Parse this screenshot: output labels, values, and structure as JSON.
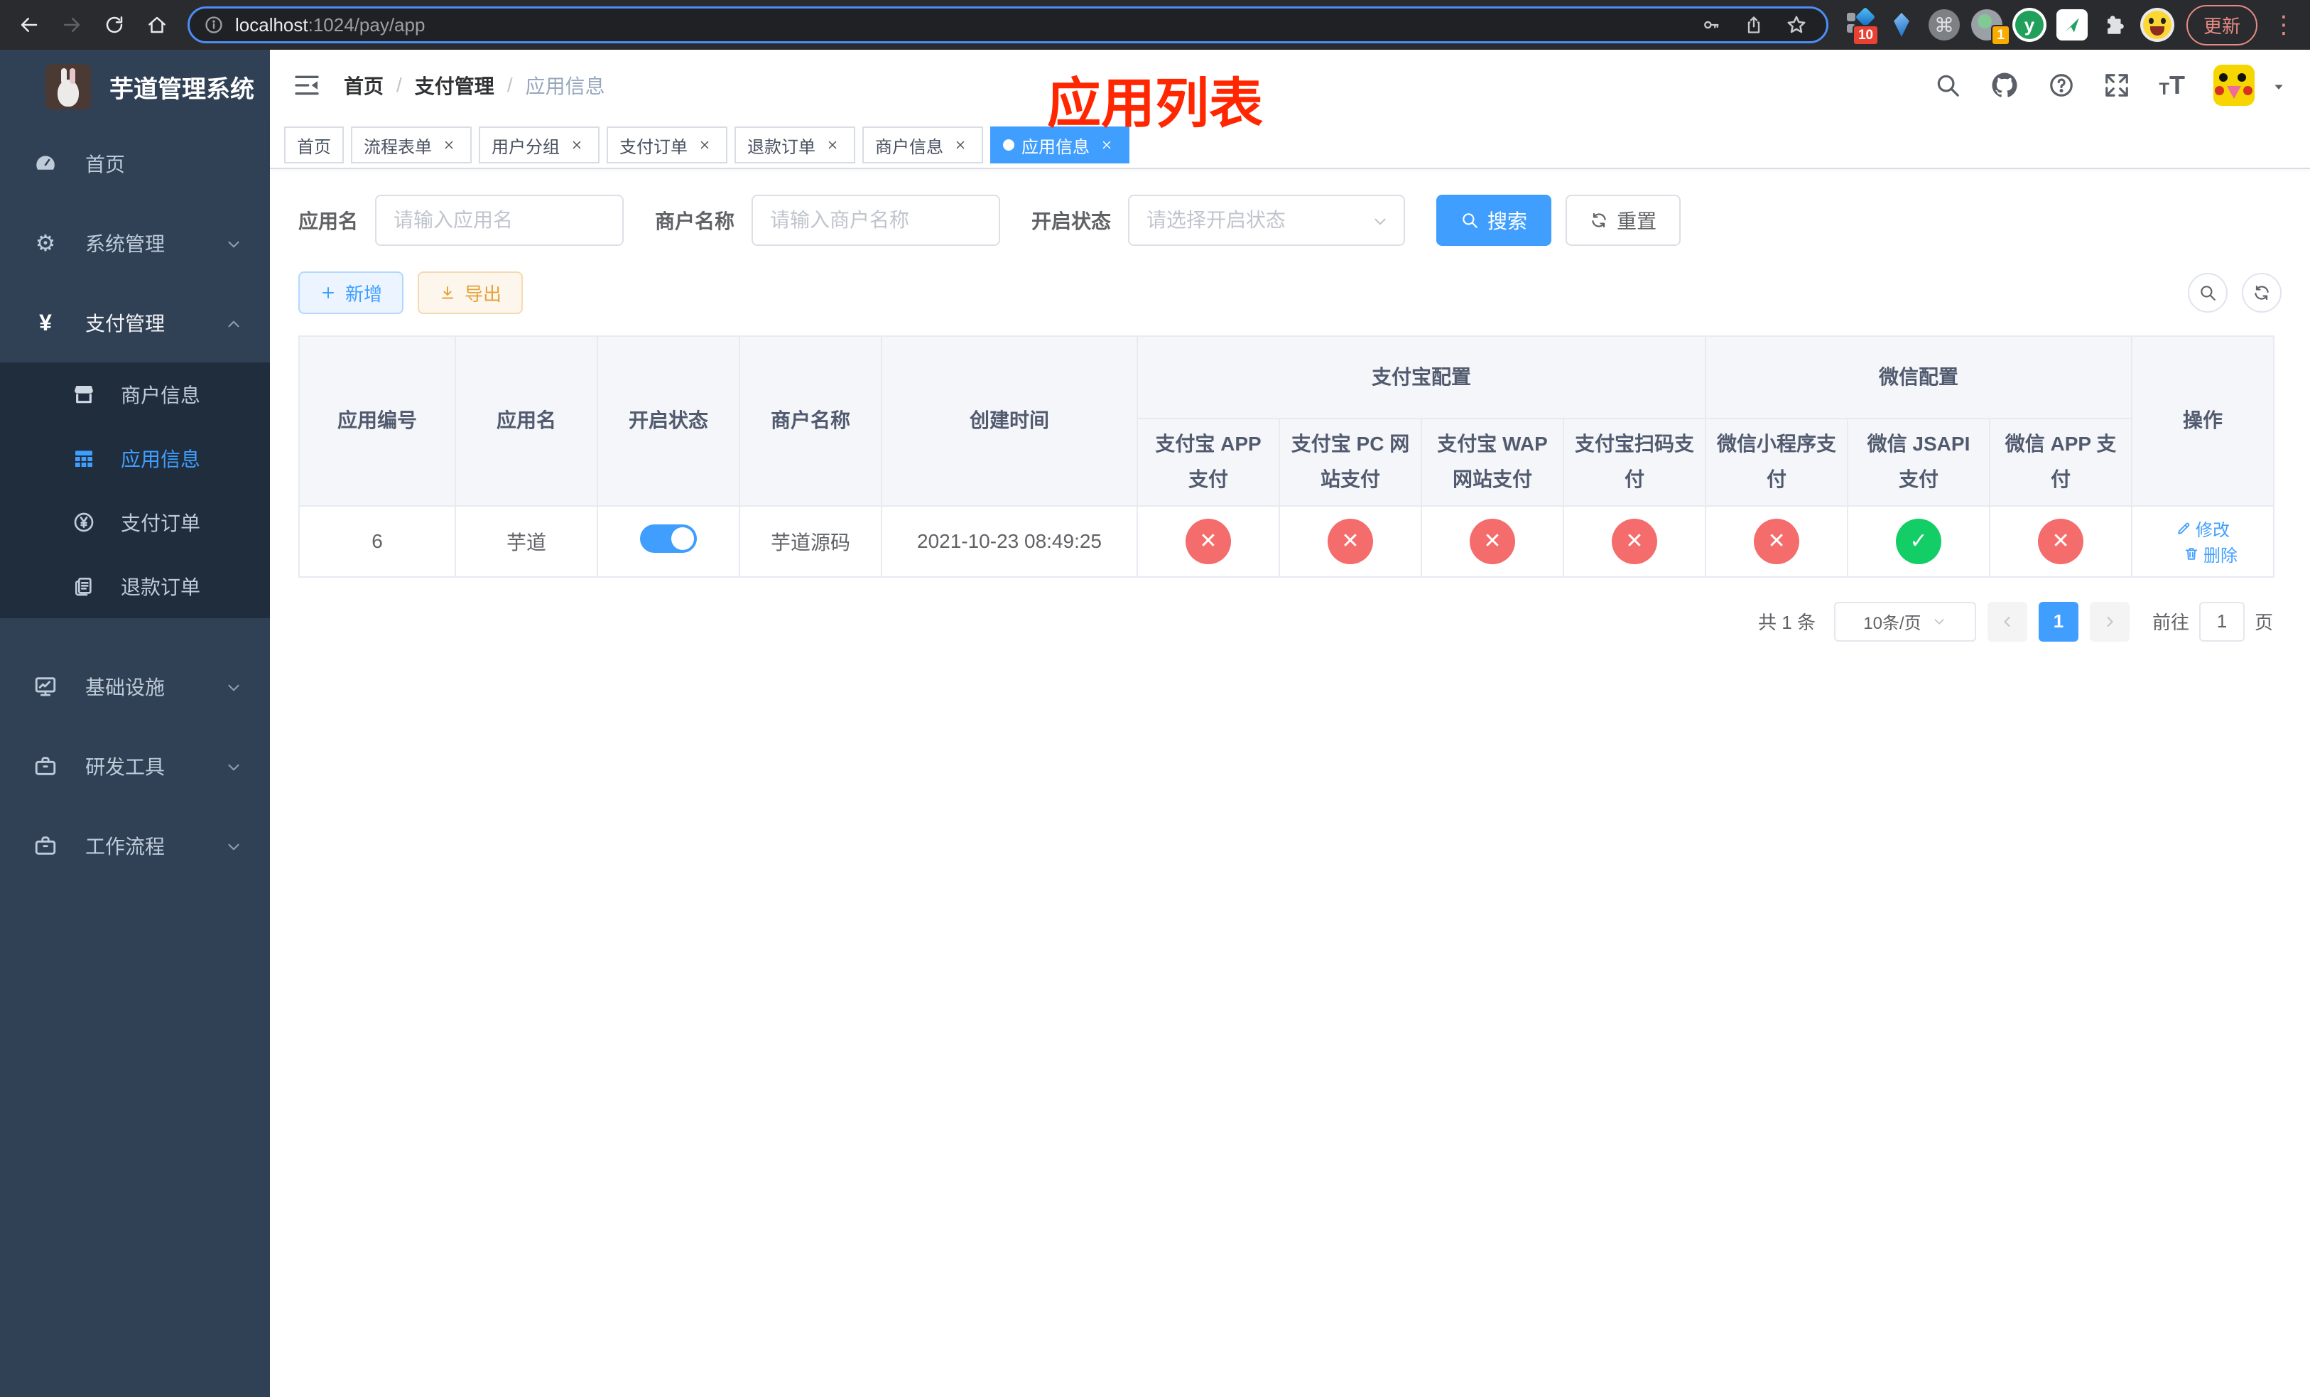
{
  "browser": {
    "url_host": "localhost",
    "url_rest": ":1024/pay/app",
    "update_label": "更新",
    "ext_badge_red": "10",
    "ext_badge_orange": "1",
    "y_ext_letter": "y",
    "cmd_glyph": "⌘",
    "dots_glyph": "⋮"
  },
  "sidebar": {
    "title": "芋道管理系统",
    "items": [
      {
        "label": "首页"
      },
      {
        "label": "系统管理"
      },
      {
        "label": "支付管理"
      },
      {
        "label": "商户信息"
      },
      {
        "label": "应用信息"
      },
      {
        "label": "支付订单"
      },
      {
        "label": "退款订单"
      },
      {
        "label": "基础设施"
      },
      {
        "label": "研发工具"
      },
      {
        "label": "工作流程"
      }
    ],
    "yen_glyph": "¥",
    "gear_glyph": "⚙"
  },
  "breadcrumb": {
    "items": [
      "首页",
      "支付管理",
      "应用信息"
    ],
    "separator": "/"
  },
  "annotation": {
    "title": "应用列表"
  },
  "tabs": [
    {
      "label": "首页"
    },
    {
      "label": "流程表单"
    },
    {
      "label": "用户分组"
    },
    {
      "label": "支付订单"
    },
    {
      "label": "退款订单"
    },
    {
      "label": "商户信息"
    },
    {
      "label": "应用信息"
    }
  ],
  "filters": {
    "app_name_label": "应用名",
    "app_name_placeholder": "请输入应用名",
    "merchant_label": "商户名称",
    "merchant_placeholder": "请输入商户名称",
    "status_label": "开启状态",
    "status_placeholder": "请选择开启状态",
    "search_label": "搜索",
    "reset_label": "重置"
  },
  "toolbar": {
    "add_label": "新增",
    "export_label": "导出"
  },
  "table": {
    "columns": {
      "id": "应用编号",
      "name": "应用名",
      "status": "开启状态",
      "merchant": "商户名称",
      "created": "创建时间",
      "op": "操作"
    },
    "groups": {
      "alipay": "支付宝配置",
      "wechat": "微信配置"
    },
    "sub_columns": [
      "支付宝 APP 支付",
      "支付宝 PC 网站支付",
      "支付宝 WAP 网站支付",
      "支付宝扫码支付",
      "微信小程序支付",
      "微信 JSAPI 支付",
      "微信 APP 支付"
    ],
    "row": {
      "id": "6",
      "name": "芋道",
      "enabled": true,
      "merchant": "芋道源码",
      "created": "2021-10-23 08:49:25",
      "channels": [
        false,
        false,
        false,
        false,
        false,
        true,
        false
      ]
    },
    "ops": {
      "edit": "修改",
      "delete": "删除"
    }
  },
  "pagination": {
    "total": "共 1 条",
    "page_size": "10条/页",
    "page": "1",
    "goto_label": "前往",
    "goto_value": "1",
    "page_suffix": "页"
  },
  "colors": {
    "accent": "#409eff",
    "success": "#13ce66",
    "danger": "#f56c6c",
    "warning": "#e6a23c",
    "annotation_red": "#ff2600",
    "sidebar_bg": "#304156",
    "submenu_bg": "#1f2d3d"
  }
}
